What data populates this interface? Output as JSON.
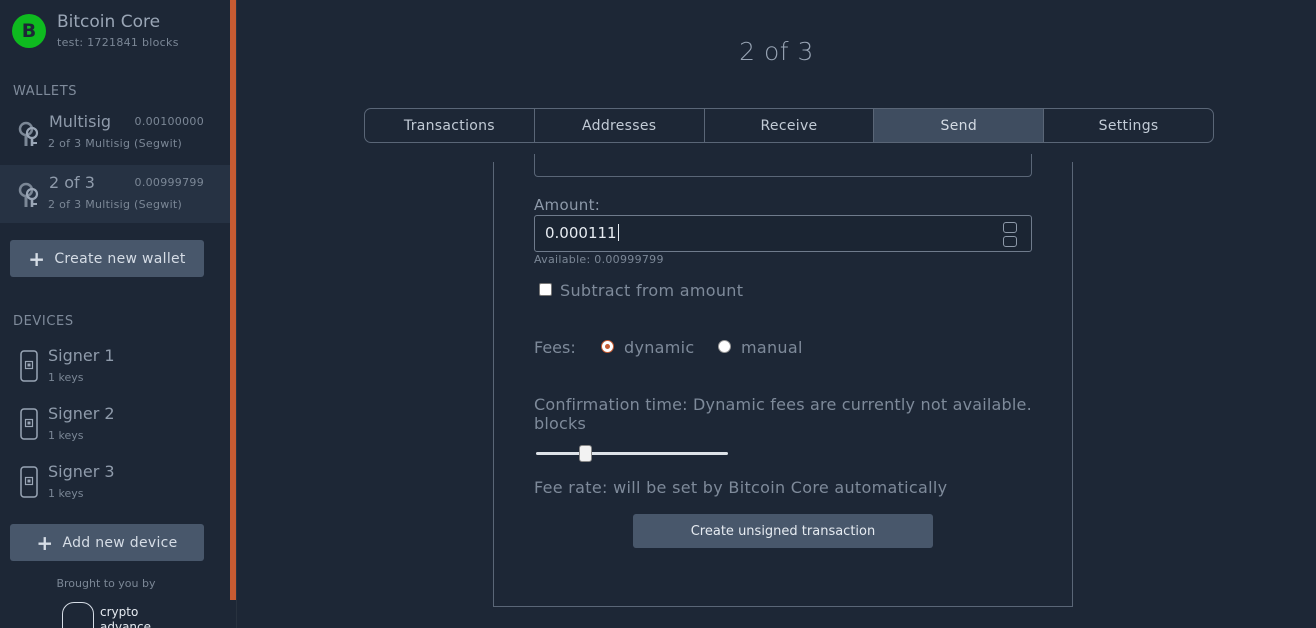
{
  "app": {
    "name": "Bitcoin Core",
    "network_info": "test: 1721841 blocks",
    "logo_glyph": "B"
  },
  "sidebar": {
    "wallets_title": "WALLETS",
    "wallets": [
      {
        "name": "Multisig",
        "balance": "0.00100000",
        "subtitle": "2 of 3 Multisig (Segwit)",
        "active": false
      },
      {
        "name": "2 of 3",
        "balance": "0.00999799",
        "subtitle": "2 of 3 Multisig (Segwit)",
        "active": true
      }
    ],
    "create_wallet_label": "Create new wallet",
    "devices_title": "DEVICES",
    "devices": [
      {
        "name": "Signer 1",
        "subtitle": "1 keys"
      },
      {
        "name": "Signer 2",
        "subtitle": "1 keys"
      },
      {
        "name": "Signer 3",
        "subtitle": "1 keys"
      }
    ],
    "add_device_label": "Add new device",
    "brought_by": "Brought to you by",
    "vendor_logo_text": [
      "crypto",
      "advance"
    ]
  },
  "main": {
    "title": "2 of 3",
    "tabs": [
      "Transactions",
      "Addresses",
      "Receive",
      "Send",
      "Settings"
    ],
    "active_tab": "Send"
  },
  "send_form": {
    "amount_label": "Amount:",
    "amount_value": "0.000111",
    "available": "Available: 0.00999799",
    "subtract_label": "Subtract from amount",
    "subtract_checked": false,
    "fees_label": "Fees:",
    "fee_options": [
      "dynamic",
      "manual"
    ],
    "fee_selected": "dynamic",
    "confirmation_text": "Confirmation time: Dynamic fees are currently not available. blocks",
    "slider_level": 0.25,
    "fee_rate_text": "Fee rate: will be set by Bitcoin Core automatically",
    "submit_label": "Create unsigned transaction"
  },
  "colors": {
    "accent": "#c75b32",
    "bitcoin_green": "#0eba1f",
    "background": "#1d2736"
  }
}
